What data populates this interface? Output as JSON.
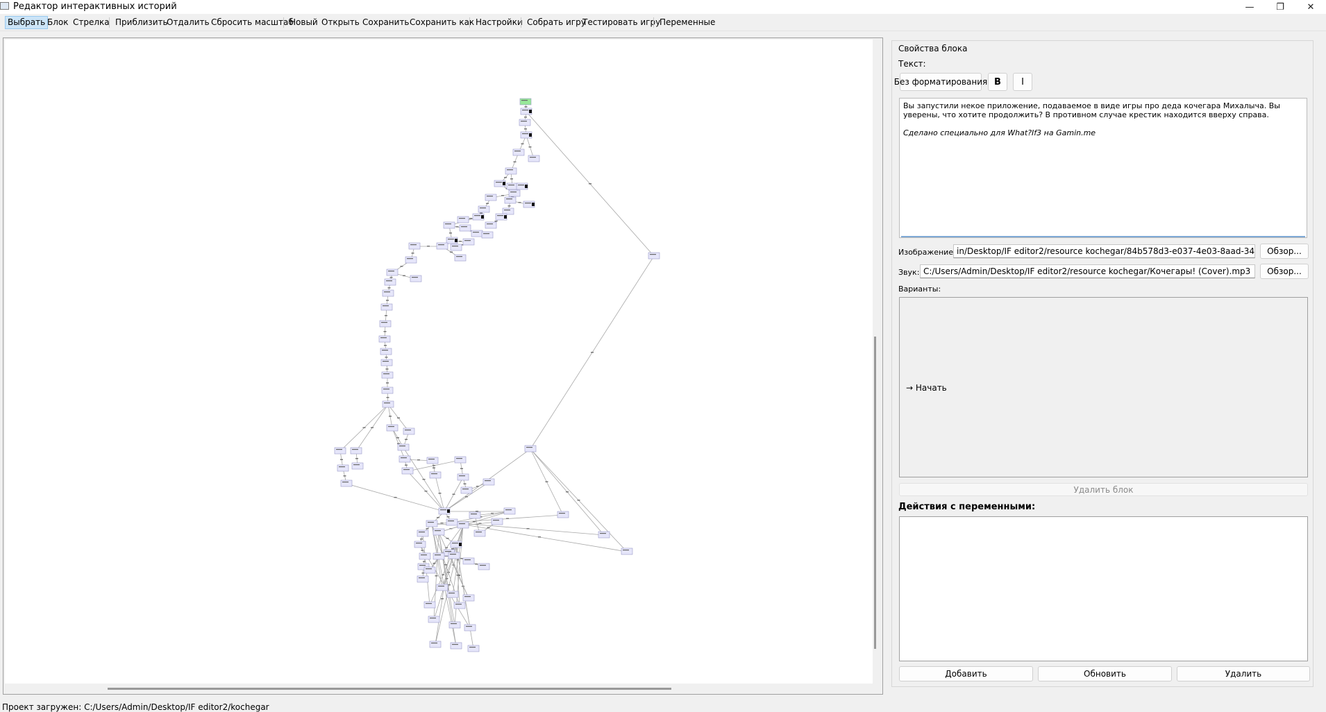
{
  "window": {
    "title": "Редактор интерактивных историй",
    "controls": [
      "—",
      "❐",
      "✕"
    ]
  },
  "toolbar": {
    "select": "Выбрать",
    "block": "Блок",
    "arrow": "Стрелка",
    "zoom_in": "Приблизить",
    "zoom_out": "Отдалить",
    "reset_zoom": "Сбросить масштаб",
    "new": "Новый",
    "open": "Открыть",
    "save": "Сохранить",
    "save_as": "Сохранить как",
    "settings": "Настройки",
    "build": "Собрать игру",
    "test": "Тестировать игру",
    "variables": "Переменные"
  },
  "colors": {
    "node_fill": "#e6e6fa",
    "node_border": "#9a9ac8",
    "start_node": "#98e898",
    "edge": "#a8a8a8"
  },
  "panel": {
    "group_title": "Свойства блока",
    "text_label": "Текст:",
    "fmt_none": "Без форматирования",
    "fmt_bold": "B",
    "fmt_italic": "I",
    "text_paragraph": "Вы запустили некое приложение, подаваемое в виде игры про деда кочегара Михалыча. Вы уверены, что хотите продолжить? В противном случае крестик находится вверху справа.",
    "text_italic": "Сделано специально для What?If3 на Gamin.me",
    "image_label": "Изображение:",
    "image_value": "in/Desktop/IF editor2/resource kochegar/84b578d3-e037-4e03-8aad-34aa4a0ba963.png",
    "browse": "Обзор...",
    "sound_label": "Звук:",
    "sound_value": "C:/Users/Admin/Desktop/IF editor2/resource kochegar/Кочегары! (Cover).mp3",
    "variants_label": "Варианты:",
    "variant_item": "→ Начать",
    "delete_block": "Удалить блок",
    "var_actions_title": "Действия с переменными:",
    "add": "Добавить",
    "update": "Обновить",
    "remove": "Удалить"
  },
  "status": {
    "text": "Проект загружен: C:/Users/Admin/Desktop/IF editor2/kochegar"
  }
}
